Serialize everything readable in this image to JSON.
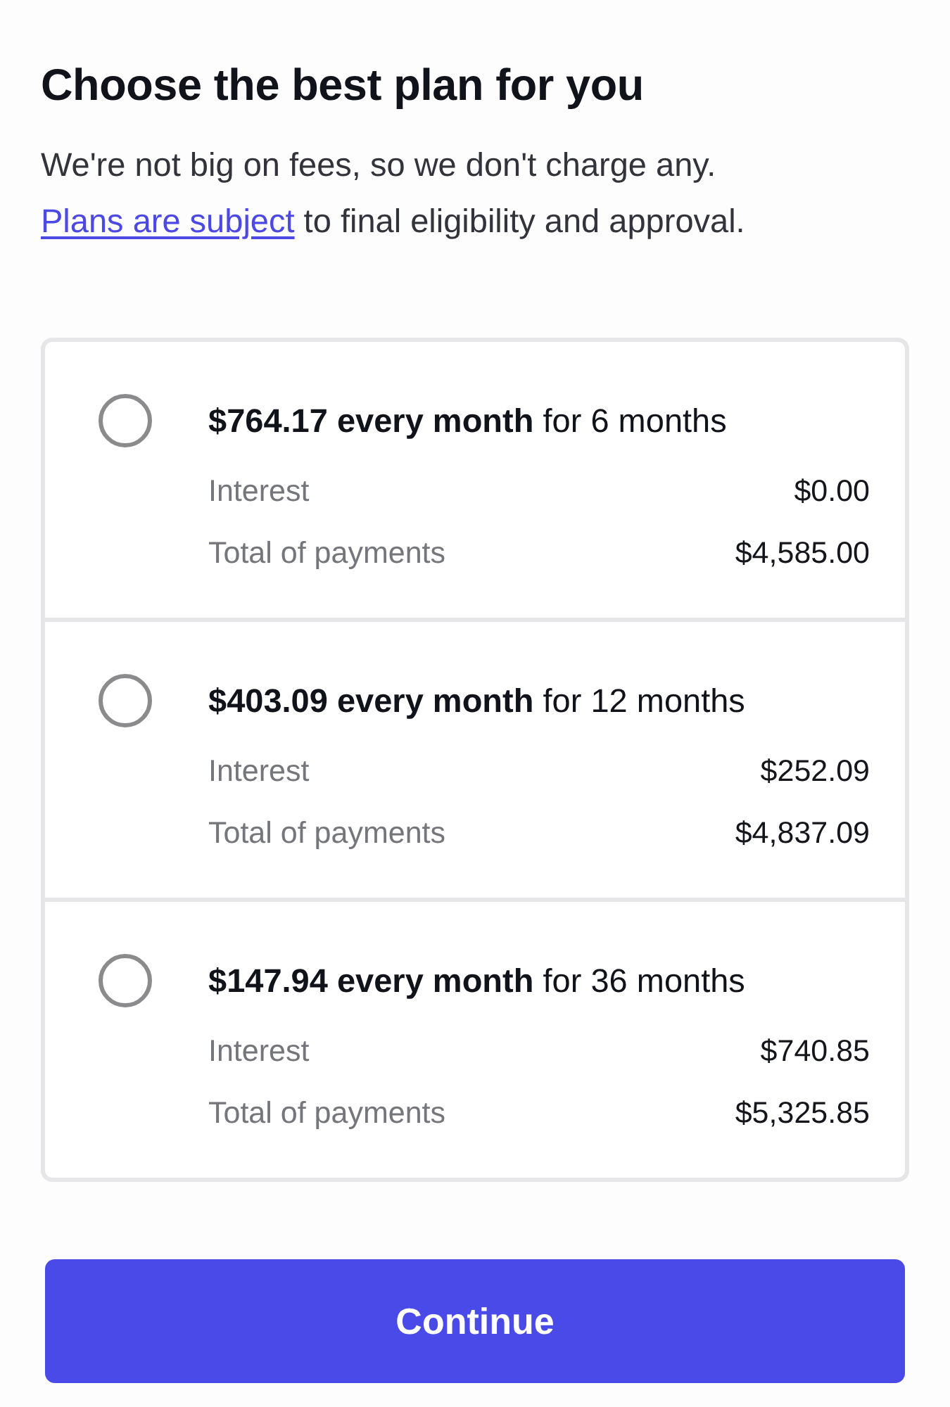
{
  "heading": "Choose the best plan for you",
  "intro": {
    "sentence": "We're not big on fees, so we don't charge any.",
    "link": "Plans are subject",
    "link_rest": "to final eligibility and approval."
  },
  "plans": [
    {
      "selected": false,
      "headline": "**$764.17 every month** for 6 months",
      "details": [
        {
          "label": "Interest",
          "value": "$0.00"
        },
        {
          "label": "Total of payments",
          "value": "$4,585.00"
        }
      ]
    },
    {
      "selected": false,
      "headline": "**$403.09 every month** for 12 months",
      "details": [
        {
          "label": "Interest",
          "value": "$252.09"
        },
        {
          "label": "Total of payments",
          "value": "$4,837.09"
        }
      ]
    },
    {
      "selected": false,
      "headline": "**$147.94 every month** for 36 months",
      "details": [
        {
          "label": "Interest",
          "value": "$740.85"
        },
        {
          "label": "Total of payments",
          "value": "$5,325.85"
        }
      ]
    }
  ],
  "continue_button": "Continue"
}
